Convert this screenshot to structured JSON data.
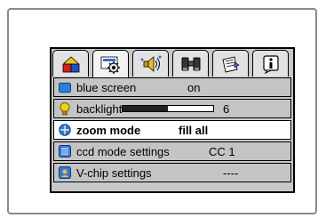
{
  "tabs": [
    {
      "icon": "picture-icon",
      "active": false
    },
    {
      "icon": "settings-gear-icon",
      "active": true
    },
    {
      "icon": "audio-speaker-icon",
      "active": false
    },
    {
      "icon": "binoculars-icon",
      "active": false
    },
    {
      "icon": "document-list-icon",
      "active": false
    },
    {
      "icon": "info-icon",
      "active": false
    }
  ],
  "menu": [
    {
      "label": "blue screen",
      "value": "on",
      "icon": "blue-screen-icon"
    },
    {
      "label": "backlight",
      "value": "6",
      "icon": "lightbulb-icon",
      "level": 0.5
    },
    {
      "label": "zoom mode",
      "value": "fill all",
      "icon": "zoom-mode-icon",
      "selected": true
    },
    {
      "label": "ccd mode settings",
      "value": "CC 1",
      "icon": "ccd-icon"
    },
    {
      "label": "V-chip settings",
      "value": "----",
      "icon": "vchip-icon"
    }
  ]
}
